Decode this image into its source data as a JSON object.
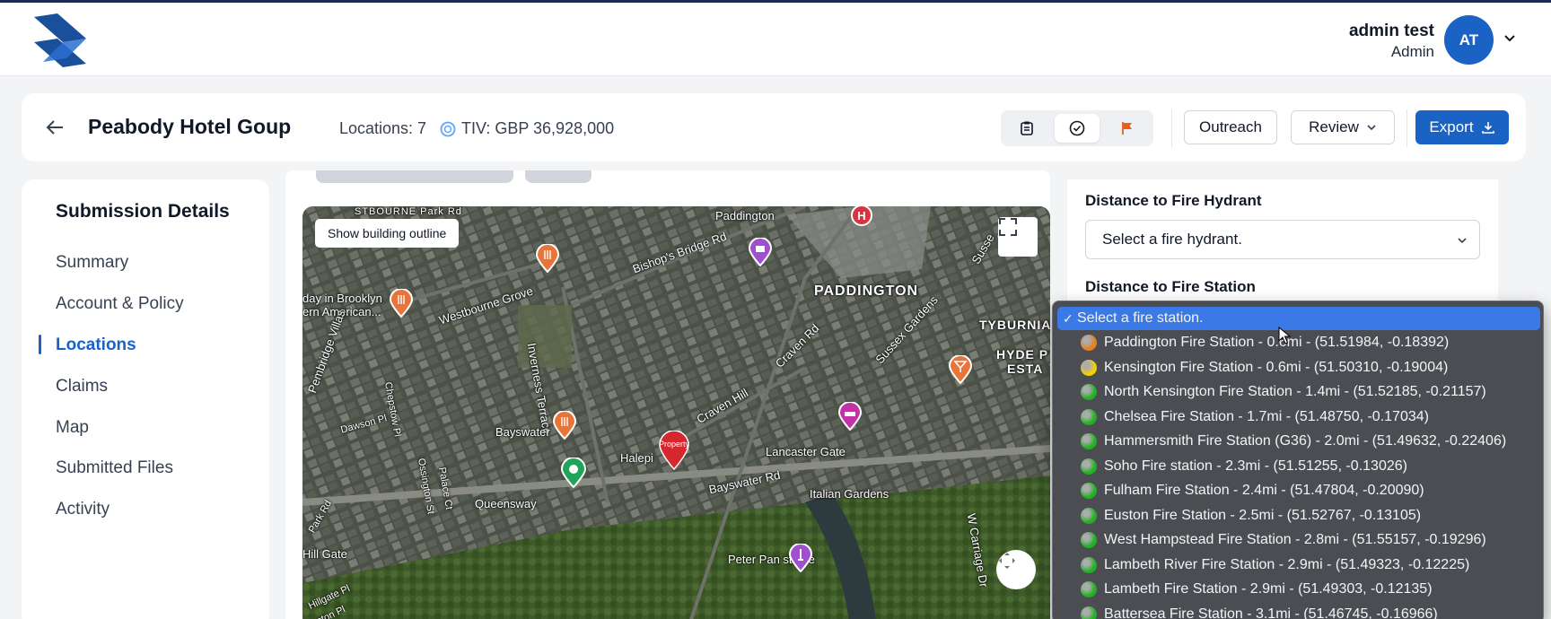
{
  "header": {
    "user_name": "admin test",
    "user_role": "Admin",
    "avatar_initials": "AT"
  },
  "page": {
    "title": "Peabody Hotel Goup",
    "locations_label": "Locations: 7",
    "tiv_label": "TIV: GBP 36,928,000",
    "outreach_label": "Outreach",
    "review_label": "Review",
    "export_label": "Export"
  },
  "sidebar": {
    "title": "Submission Details",
    "items": [
      {
        "label": "Summary"
      },
      {
        "label": "Account & Policy"
      },
      {
        "label": "Locations",
        "active": true
      },
      {
        "label": "Claims"
      },
      {
        "label": "Map"
      },
      {
        "label": "Submitted Files"
      },
      {
        "label": "Activity"
      }
    ]
  },
  "map": {
    "show_outline_label": "Show building outline",
    "labels": {
      "paddington_station": "Paddington",
      "paddington_area": "PADDINGTON",
      "tyburnia": "TYBURNIA",
      "hyde_park": "HYDE P",
      "estate": "ESTA",
      "bishops_bridge": "Bishop's Bridge Rd",
      "westbourne_grove": "Westbourne Grove",
      "inverness_terrace": "Inverness Terrace",
      "craven_rd": "Craven Rd",
      "craven_hill": "Craven Hill",
      "sussex_gardens": "Sussex Gardens",
      "sussex_sq": "Susse",
      "pembridge_villas": "Pembridge Villas",
      "chepstow_pl": "Chepstow Pl",
      "dawson_pl": "Dawson Pl",
      "bayswater": "Bayswater",
      "halepi": "Halepi",
      "lancaster_gate": "Lancaster Gate",
      "bayswater_rd": "Bayswater Rd",
      "italian_gardens": "Italian Gardens",
      "queensway": "Queensway",
      "ossington_st": "Ossington St",
      "palace_ct": "Palace Ct",
      "park_rd": "Park Rd",
      "hill_gate": "Hill Gate",
      "hillgate_pl": "Hillgate Pl",
      "ston_pl": "ston Pl",
      "peter_pan": "Peter Pan statue",
      "w_carriage_dr": "W Carriage Dr",
      "brooklyn": "day in Brooklyn",
      "american": "ern American...",
      "westbourne_park_rd": "STBOURNE Park Rd",
      "property_marker": "Property"
    }
  },
  "fire": {
    "hydrant_label": "Distance to Fire Hydrant",
    "hydrant_placeholder": "Select a fire hydrant.",
    "station_label": "Distance to Fire Station",
    "station_placeholder": "Select a fire station.",
    "options": [
      {
        "text": "Paddington Fire Station - 0.6mi - (51.51984, -0.18392)",
        "color": "#e8801a"
      },
      {
        "text": "Kensington Fire Station - 0.6mi - (51.50310, -0.19004)",
        "color": "#f5d000"
      },
      {
        "text": "North Kensington Fire Station - 1.4mi - (51.52185, -0.21157)",
        "color": "#1fb11f"
      },
      {
        "text": "Chelsea Fire Station - 1.7mi - (51.48750, -0.17034)",
        "color": "#1fb11f"
      },
      {
        "text": "Hammersmith Fire Station (G36) - 2.0mi - (51.49632, -0.22406)",
        "color": "#1fb11f"
      },
      {
        "text": "Soho Fire station - 2.3mi - (51.51255, -0.13026)",
        "color": "#1fb11f"
      },
      {
        "text": "Fulham Fire Station - 2.4mi - (51.47804, -0.20090)",
        "color": "#1fb11f"
      },
      {
        "text": "Euston Fire Station - 2.5mi - (51.52767, -0.13105)",
        "color": "#1fb11f"
      },
      {
        "text": "West Hampstead Fire Station - 2.8mi - (51.55157, -0.19296)",
        "color": "#1fb11f"
      },
      {
        "text": "Lambeth River Fire Station - 2.9mi - (51.49323, -0.12225)",
        "color": "#1fb11f"
      },
      {
        "text": "Lambeth Fire Station - 2.9mi - (51.49303, -0.12135)",
        "color": "#1fb11f"
      },
      {
        "text": "Battersea Fire Station - 3.1mi - (51.46745, -0.16966)",
        "color": "#1fb11f"
      }
    ]
  },
  "colors": {
    "accent": "#1a62c4",
    "dropdown_bg": "#4b4d52",
    "dropdown_selected": "#3b79e6"
  }
}
